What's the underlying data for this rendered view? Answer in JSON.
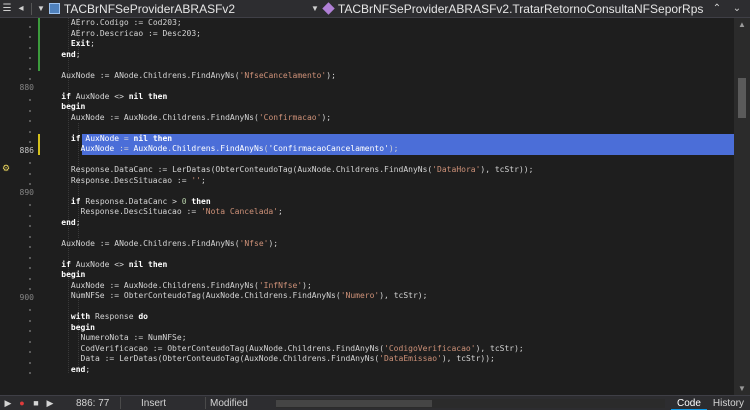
{
  "toolbar": {
    "class_combo": "TACBrNFSeProviderABRASFv2",
    "method_combo": "TACBrNFSeProviderABRASFv2.TratarRetornoConsultaNFSeporRps"
  },
  "gutter": {
    "line_numbers": [
      "880",
      "886",
      "890",
      "900"
    ]
  },
  "code_lines": [
    "      AErro.Codigo := Cod203;",
    "      AErro.Descricao := Desc203;",
    "      Exit;",
    "    end;",
    "",
    "    AuxNode := ANode.Childrens.FindAnyNs('NfseCancelamento');",
    "",
    "    if AuxNode <> nil then",
    "    begin",
    "      AuxNode := AuxNode.Childrens.FindAnyNs('Confirmacao');",
    "",
    "      if AuxNode = nil then",
    "        AuxNode := AuxNode.Childrens.FindAnyNs('ConfirmacaoCancelamento');",
    "",
    "      Response.DataCanc := LerDatas(ObterConteudoTag(AuxNode.Childrens.FindAnyNs('DataHora'), tcStr));",
    "      Response.DescSituacao := '';",
    "",
    "      if Response.DataCanc > 0 then",
    "        Response.DescSituacao := 'Nota Cancelada';",
    "    end;",
    "",
    "    AuxNode := ANode.Childrens.FindAnyNs('Nfse');",
    "",
    "    if AuxNode <> nil then",
    "    begin",
    "      AuxNode := AuxNode.Childrens.FindAnyNs('InfNfse');",
    "      NumNFSe := ObterConteudoTag(AuxNode.Childrens.FindAnyNs('Numero'), tcStr);",
    "",
    "      with Response do",
    "      begin",
    "        NumeroNota := NumNFSe;",
    "        CodVerificacao := ObterConteudoTag(AuxNode.Childrens.FindAnyNs('CodigoVerificacao'), tcStr);",
    "        Data := LerDatas(ObterConteudoTag(AuxNode.Childrens.FindAnyNs('DataEmissao'), tcStr));",
    "      end;"
  ],
  "status": {
    "position": "886: 77",
    "mode": "Insert",
    "modified": "Modified",
    "tabs": [
      "Code",
      "History"
    ]
  },
  "colors": {
    "selection": "#4b6ed8",
    "keyword": "#ffffff",
    "string": "#ce9178",
    "number": "#b5cea8",
    "modified_bar": "#3c9b3c",
    "active_tab": "#0e9bea"
  }
}
